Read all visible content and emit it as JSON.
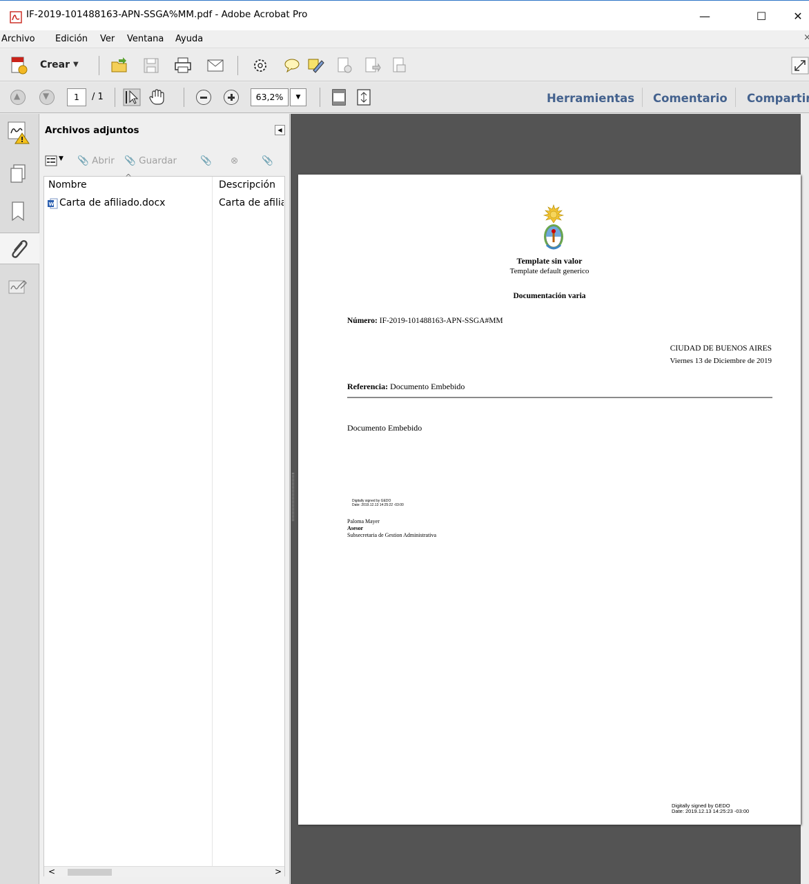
{
  "window": {
    "title": "IF-2019-101488163-APN-SSGA%MM.pdf - Adobe Acrobat Pro",
    "minimize_icon": "minimize-icon",
    "maximize_icon": "maximize-icon",
    "close_icon": "close-icon"
  },
  "menu": [
    "Archivo",
    "Edición",
    "Ver",
    "Ventana",
    "Ayuda"
  ],
  "toolbar1": {
    "create_label": "Crear",
    "icons": [
      "open-folder-icon",
      "save-icon",
      "print-icon",
      "email-icon",
      "settings-icon",
      "comment-icon",
      "highlight-icon",
      "sign-icon",
      "export-icon",
      "pages-icon"
    ]
  },
  "toolbar2": {
    "page_current": "1",
    "page_total": "/ 1",
    "zoom": "63,2%",
    "tabs": [
      "Herramientas",
      "Comentario",
      "Compartir"
    ]
  },
  "attachments": {
    "title": "Archivos adjuntos",
    "tools": {
      "open": "Abrir",
      "save": "Guardar"
    },
    "columns": [
      "Nombre",
      "Descripción"
    ],
    "rows": [
      {
        "name": "Carta de afiliado.docx",
        "description": "Carta de afiliad"
      }
    ]
  },
  "document": {
    "heading1": "Template sin valor",
    "heading2": "Template default generico",
    "doc_type": "Documentación varia",
    "number_label": "Número:",
    "number_value": "IF-2019-101488163-APN-SSGA#MM",
    "city": "CIUDAD DE BUENOS AIRES",
    "date": "Viernes 13 de Diciembre de 2019",
    "reference_label": "Referencia:",
    "reference_value": "Documento Embebido",
    "body": "Documento Embebido",
    "sig_small_1": "Digitally signed by GEDO",
    "sig_small_2": "Date: 2019.12.13 14:25:22 -03:00",
    "signer_name": "Paloma Mayer",
    "signer_role": "Asesor",
    "signer_org": "Subsecretaria de Gestion Administrativa",
    "footer_sig_1": "Digitally signed by GEDO",
    "footer_sig_2": "Date: 2019.12.13 14:25:23 -03:00"
  },
  "colors": {
    "accent": "#2b73c6",
    "tab_text": "#44628e",
    "doc_background": "#545454"
  }
}
